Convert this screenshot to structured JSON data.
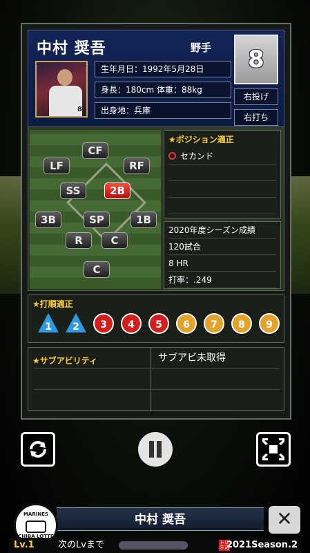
{
  "player": {
    "name": "中村 奨吾",
    "role": "野手",
    "number": "8",
    "birth": "生年月日：1992年5月28日",
    "size": "身長：180cm 体重：88kg",
    "birthplace": "出身地：兵庫",
    "throws": "右投げ",
    "bats": "右打ち",
    "photo_number": "8"
  },
  "positions": {
    "items": [
      {
        "label": "CF",
        "active": false
      },
      {
        "label": "LF",
        "active": false
      },
      {
        "label": "RF",
        "active": false
      },
      {
        "label": "SS",
        "active": false
      },
      {
        "label": "2B",
        "active": true
      },
      {
        "label": "3B",
        "active": false
      },
      {
        "label": "SP",
        "active": false
      },
      {
        "label": "1B",
        "active": false
      },
      {
        "label": "R",
        "active": false
      },
      {
        "label": "C",
        "active": false
      },
      {
        "label": "C",
        "active": false
      }
    ]
  },
  "position_aptitude": {
    "title": "★ポジション適正",
    "entries": [
      "セカンド"
    ]
  },
  "season_stats": {
    "title": "2020年度シーズン成績",
    "games": "120試合",
    "hr": "8 HR",
    "avg": "打率：.249"
  },
  "batting_order": {
    "title": "★打順適正",
    "items": [
      {
        "n": "1",
        "kind": "triangle"
      },
      {
        "n": "2",
        "kind": "triangle"
      },
      {
        "n": "3",
        "kind": "red"
      },
      {
        "n": "4",
        "kind": "red"
      },
      {
        "n": "5",
        "kind": "red"
      },
      {
        "n": "6",
        "kind": "gold"
      },
      {
        "n": "7",
        "kind": "gold"
      },
      {
        "n": "8",
        "kind": "gold"
      },
      {
        "n": "9",
        "kind": "gold"
      }
    ]
  },
  "sub_ability": {
    "title": "★サブアビリティ",
    "status": "サブアビ未取得"
  },
  "controls": {
    "refresh_icon": "refresh-icon",
    "pause_icon": "pause-icon",
    "collapse_icon": "collapse-icon"
  },
  "bottom": {
    "name": "中村 奨吾",
    "logo_top": "MARINES",
    "logo_bottom": "CHIBA LOTTE",
    "close": "✕",
    "level": "Lv.1",
    "next_level": "次のLvまで",
    "tore_badge": "トレ\n不可",
    "season": "2021Season.2"
  },
  "colors": {
    "active_position": "#d41e1e",
    "triangle": "#2f9ae0",
    "red_circle": "#d41e1e",
    "gold_circle": "#e3a32b",
    "section_title": "#ffcf3a"
  }
}
